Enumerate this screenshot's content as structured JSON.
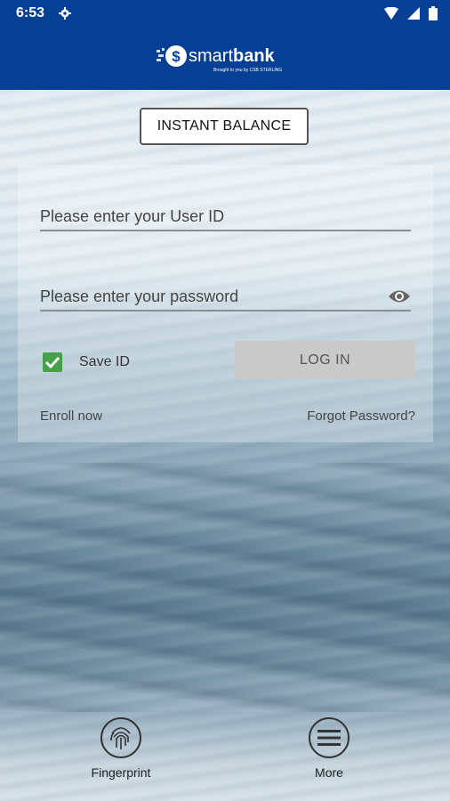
{
  "status_bar": {
    "time": "6:53"
  },
  "app_bar": {
    "logo_text_bold": "smart",
    "logo_text_rest": "bank",
    "logo_sub": "Brought to you by CSB STERLING"
  },
  "instant_balance": {
    "label": "INSTANT BALANCE"
  },
  "login_form": {
    "user_id_placeholder": "Please enter your User ID",
    "password_placeholder": "Please enter your password",
    "save_id_label": "Save ID",
    "save_id_checked": true,
    "login_label": "LOG IN",
    "enroll_label": "Enroll now",
    "forgot_label": "Forgot Password?"
  },
  "bottom_nav": {
    "fingerprint_label": "Fingerprint",
    "more_label": "More"
  },
  "colors": {
    "brand": "#063f94",
    "checkbox": "#44a14a",
    "login_button": "#c9c9c9"
  }
}
